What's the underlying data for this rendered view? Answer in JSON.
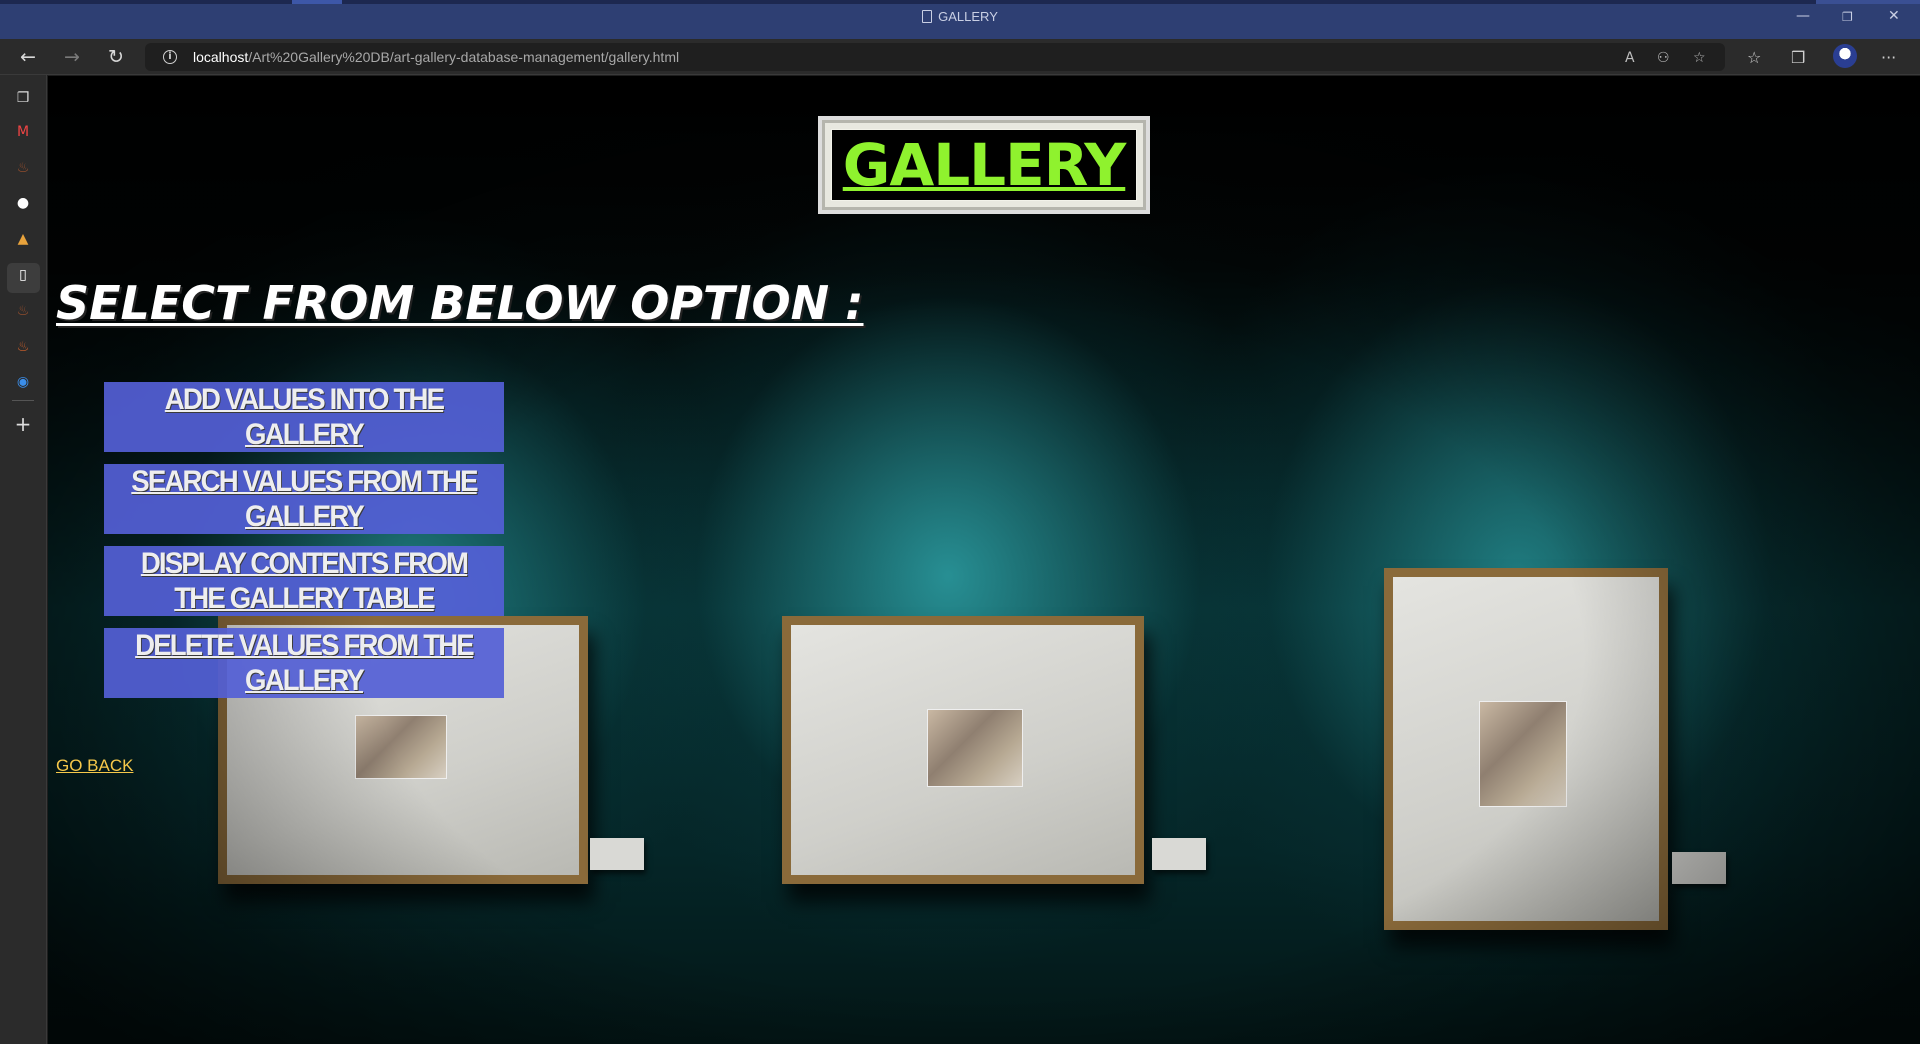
{
  "window": {
    "title": "GALLERY",
    "minimize": "—",
    "restore": "❐",
    "close": "✕"
  },
  "addressbar": {
    "url_host": "localhost",
    "url_path": "/Art%20Gallery%20DB/art-gallery-database-management/gallery.html",
    "back": "←",
    "forward": "→",
    "refresh": "↻",
    "info": "i",
    "read_aloud": "A",
    "more": "···"
  },
  "page": {
    "title": "GALLERY",
    "heading": "SELECT FROM BELOW OPTION :",
    "options": [
      {
        "label": "ADD VALUES INTO THE GALLERY"
      },
      {
        "label": "SEARCH VALUES FROM THE GALLERY"
      },
      {
        "label": "DISPLAY CONTENTS FROM THE GALLERY TABLE"
      },
      {
        "label": "DELETE VALUES FROM THE GALLERY"
      }
    ],
    "go_back": "GO BACK"
  },
  "colors": {
    "title_text": "#8ff22e",
    "button_bg": "#5460d6",
    "link": "#f6c84a"
  }
}
